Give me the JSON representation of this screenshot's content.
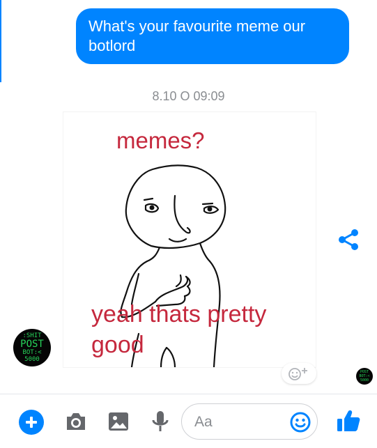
{
  "conversation": {
    "outgoing_message": "What's your favourite meme our botlord",
    "timestamp": "8.10 O 09:09",
    "meme": {
      "top_text": "memes?",
      "bottom_text": "yeah thats pretty good"
    },
    "bot_avatar": {
      "line1": ":SHIT",
      "line2": "POST",
      "line3": "BOT:<",
      "line4": "5000"
    },
    "seen_avatar": {
      "line1": "POST",
      "line2": "BOT:<",
      "line3": "5000"
    }
  },
  "composer": {
    "placeholder": "Aa"
  },
  "colors": {
    "accent": "#0084ff",
    "meme_text": "#c5283d",
    "avatar_text": "#27d35a"
  },
  "icons": [
    "share-icon",
    "add-reaction-icon",
    "plus-icon",
    "camera-icon",
    "image-icon",
    "microphone-icon",
    "emoji-icon",
    "thumbs-up-icon"
  ]
}
